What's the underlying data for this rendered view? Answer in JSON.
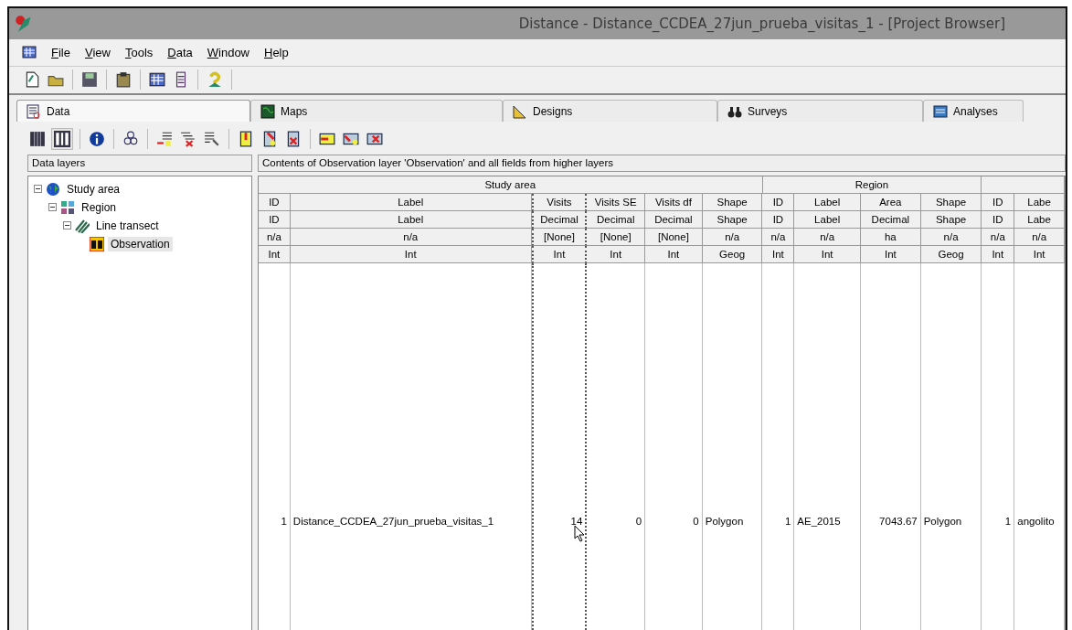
{
  "window": {
    "title": "Distance - Distance_CCDEA_27jun_prueba_visitas_1 - [Project Browser]"
  },
  "menu": [
    {
      "key": "F",
      "rest": "ile"
    },
    {
      "key": "V",
      "rest": "iew"
    },
    {
      "key": "T",
      "rest": "ools"
    },
    {
      "key": "D",
      "rest": "ata"
    },
    {
      "key": "W",
      "rest": "indow"
    },
    {
      "key": "H",
      "rest": "elp"
    }
  ],
  "tabs": [
    {
      "label": "Data",
      "selected": true
    },
    {
      "label": "Maps",
      "selected": false
    },
    {
      "label": "Designs",
      "selected": false
    },
    {
      "label": "Surveys",
      "selected": false
    },
    {
      "label": "Analyses",
      "selected": false
    }
  ],
  "data_layers": {
    "title": "Data layers",
    "tree": [
      {
        "label": "Study area",
        "expanded": true,
        "selected": false,
        "children": [
          {
            "label": "Region",
            "expanded": true,
            "selected": false,
            "children": [
              {
                "label": "Line transect",
                "expanded": true,
                "selected": false,
                "children": [
                  {
                    "label": "Observation",
                    "selected": true
                  }
                ]
              }
            ]
          }
        ]
      }
    ]
  },
  "contents": {
    "title": "Contents of Observation layer 'Observation' and all fields from higher layers",
    "groups": [
      {
        "label": "Study area",
        "columns": [
          {
            "name": "ID",
            "type": "ID",
            "units": "n/a",
            "storage": "Int",
            "value": "1",
            "kind": "number",
            "selected": false
          },
          {
            "name": "Label",
            "type": "Label",
            "units": "n/a",
            "storage": "Int",
            "value": "Distance_CCDEA_27jun_prueba_visitas_1",
            "kind": "text",
            "selected": false
          },
          {
            "name": "Visits",
            "type": "Decimal",
            "units": "[None]",
            "storage": "Int",
            "value": "14",
            "kind": "number",
            "selected": true
          },
          {
            "name": "Visits SE",
            "type": "Decimal",
            "units": "[None]",
            "storage": "Int",
            "value": "0",
            "kind": "number",
            "selected": false
          },
          {
            "name": "Visits df",
            "type": "Decimal",
            "units": "[None]",
            "storage": "Int",
            "value": "0",
            "kind": "number",
            "selected": false
          },
          {
            "name": "Shape",
            "type": "Shape",
            "units": "n/a",
            "storage": "Geog",
            "value": "Polygon",
            "kind": "text",
            "selected": false
          }
        ]
      },
      {
        "label": "Region",
        "columns": [
          {
            "name": "ID",
            "type": "ID",
            "units": "n/a",
            "storage": "Int",
            "value": "1",
            "kind": "number",
            "selected": false
          },
          {
            "name": "Label",
            "type": "Label",
            "units": "n/a",
            "storage": "Int",
            "value": "AE_2015",
            "kind": "text",
            "selected": false
          },
          {
            "name": "Area",
            "type": "Decimal",
            "units": "ha",
            "storage": "Int",
            "value": "7043.67",
            "kind": "number",
            "selected": false
          },
          {
            "name": "Shape",
            "type": "Shape",
            "units": "n/a",
            "storage": "Geog",
            "value": "Polygon",
            "kind": "text",
            "selected": false
          }
        ]
      },
      {
        "columns": [
          {
            "name": "ID",
            "type": "ID",
            "units": "n/a",
            "storage": "Int",
            "value": "1",
            "kind": "number",
            "selected": false
          },
          {
            "name": "Labe",
            "type": "Labe",
            "units": "n/a",
            "storage": "Int",
            "value": "angolito",
            "kind": "text",
            "selected": false
          }
        ]
      }
    ]
  }
}
